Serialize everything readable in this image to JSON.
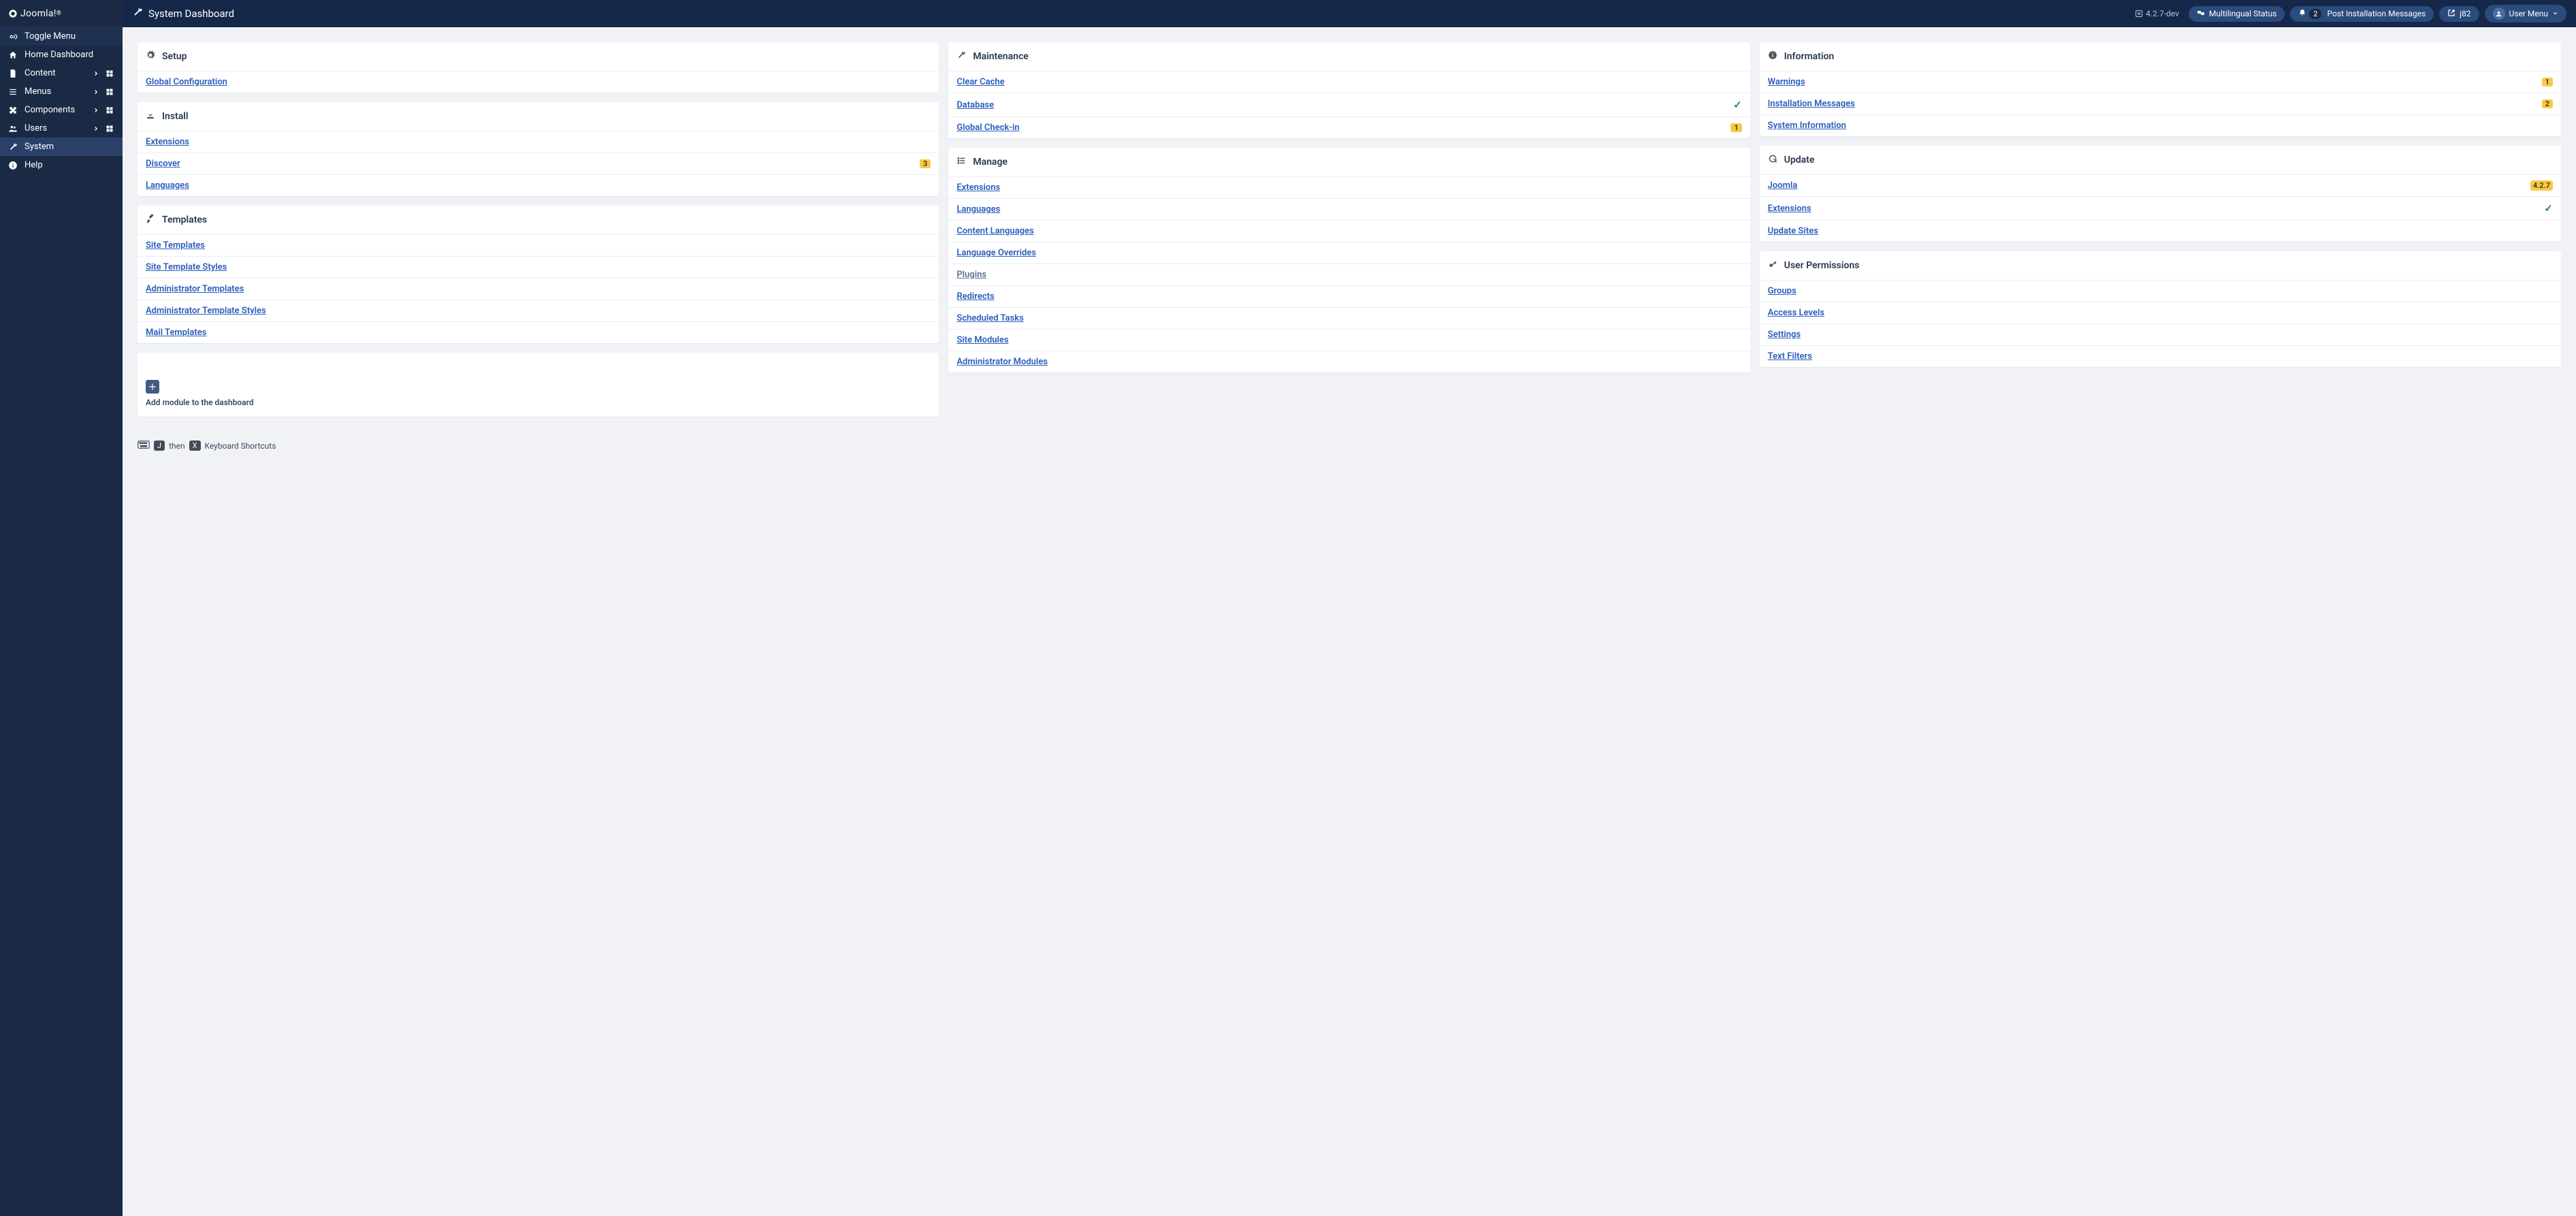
{
  "brand": "Joomla!",
  "topbar": {
    "title": "System Dashboard",
    "version_prefix": "4.2.7-dev",
    "multilingual": "Multilingual Status",
    "pim_count": "2",
    "pim_label": "Post Installation Messages",
    "site_short": "j82",
    "user_menu": "User Menu"
  },
  "sidebar": {
    "toggle": "Toggle Menu",
    "items": [
      {
        "label": "Home Dashboard"
      },
      {
        "label": "Content"
      },
      {
        "label": "Menus"
      },
      {
        "label": "Components"
      },
      {
        "label": "Users"
      },
      {
        "label": "System"
      },
      {
        "label": "Help"
      }
    ]
  },
  "cards": {
    "setup": {
      "title": "Setup",
      "items": [
        {
          "label": "Global Configuration"
        }
      ]
    },
    "install": {
      "title": "Install",
      "items": [
        {
          "label": "Extensions"
        },
        {
          "label": "Discover",
          "badge": "3"
        },
        {
          "label": "Languages"
        }
      ]
    },
    "templates": {
      "title": "Templates",
      "items": [
        {
          "label": "Site Templates"
        },
        {
          "label": "Site Template Styles"
        },
        {
          "label": "Administrator Templates"
        },
        {
          "label": "Administrator Template Styles"
        },
        {
          "label": "Mail Templates"
        }
      ]
    },
    "maintenance": {
      "title": "Maintenance",
      "items": [
        {
          "label": "Clear Cache"
        },
        {
          "label": "Database",
          "check": true
        },
        {
          "label": "Global Check-in",
          "badge": "1"
        }
      ]
    },
    "manage": {
      "title": "Manage",
      "items": [
        {
          "label": "Extensions"
        },
        {
          "label": "Languages"
        },
        {
          "label": "Content Languages"
        },
        {
          "label": "Language Overrides"
        },
        {
          "label": "Plugins",
          "hover": true
        },
        {
          "label": "Redirects"
        },
        {
          "label": "Scheduled Tasks"
        },
        {
          "label": "Site Modules"
        },
        {
          "label": "Administrator Modules"
        }
      ]
    },
    "information": {
      "title": "Information",
      "items": [
        {
          "label": "Warnings",
          "badge": "1"
        },
        {
          "label": "Installation Messages",
          "badge": "2"
        },
        {
          "label": "System Information"
        }
      ]
    },
    "update": {
      "title": "Update",
      "items": [
        {
          "label": "Joomla",
          "ver": "4.2.7"
        },
        {
          "label": "Extensions",
          "check": true
        },
        {
          "label": "Update Sites"
        }
      ]
    },
    "permissions": {
      "title": "User Permissions",
      "items": [
        {
          "label": "Groups"
        },
        {
          "label": "Access Levels"
        },
        {
          "label": "Settings"
        },
        {
          "label": "Text Filters"
        }
      ]
    }
  },
  "add_module": "Add module to the dashboard",
  "footer": {
    "j": "J",
    "then": "then",
    "x": "X",
    "label": "Keyboard Shortcuts"
  }
}
